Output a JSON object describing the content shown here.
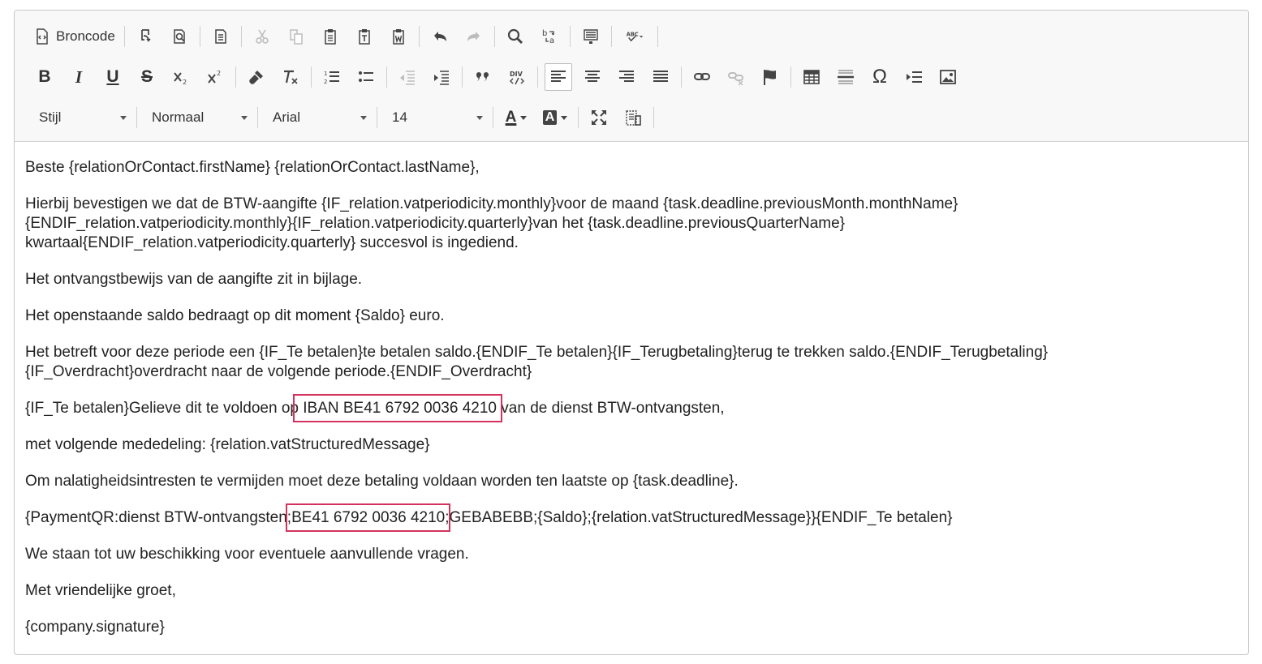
{
  "toolbar": {
    "source_label": "Broncode",
    "style_select": "Stijl",
    "format_select": "Normaal",
    "font_select": "Arial",
    "size_select": "14",
    "text_color_letter": "A",
    "bg_color_letter": "A",
    "bold_letter": "B",
    "italic_letter": "I",
    "underline_letter": "U",
    "strike_letter": "S",
    "omega_symbol": "Ω",
    "quote_symbol": "❞"
  },
  "content": {
    "greeting": "Beste {relationOrContact.firstName} {relationOrContact.lastName},",
    "p1_line1": "Hierbij bevestigen we dat de BTW-aangifte {IF_relation.vatperiodicity.monthly}voor de maand {task.deadline.previousMonth.monthName}",
    "p1_line2": "{ENDIF_relation.vatperiodicity.monthly}{IF_relation.vatperiodicity.quarterly}van het {task.deadline.previousQuarterName}",
    "p1_line3": "kwartaal{ENDIF_relation.vatperiodicity.quarterly} succesvol is ingediend.",
    "p2": "Het ontvangstbewijs van de aangifte zit in bijlage.",
    "p3": "Het openstaande saldo bedraagt op dit moment {Saldo} euro.",
    "p4_line1": "Het betreft voor deze periode een {IF_Te betalen}te betalen saldo.{ENDIF_Te betalen}{IF_Terugbetaling}terug te trekken saldo.{ENDIF_Terugbetaling}",
    "p4_line2": "{IF_Overdracht}overdracht naar de volgende periode.{ENDIF_Overdracht}",
    "p5_before": "{IF_Te betalen}Gelieve dit te voldoen op",
    "p5_highlight": " IBAN BE41 6792 0036 4210",
    "p5_after": " van de dienst BTW-ontvangsten,",
    "p6": "met volgende mededeling: {relation.vatStructuredMessage}",
    "p7": "Om nalatigheidsintresten te vermijden moet deze betaling voldaan worden ten laatste op {task.deadline}.",
    "p8_before": "{PaymentQR:dienst BTW-ontvangsten;",
    "p8_highlight": "BE41 6792 0036 4210",
    "p8_after": ";GEBABEBB;{Saldo};{relation.vatStructuredMessage}}{ENDIF_Te betalen}",
    "p9": "We staan tot uw beschikking voor eventuele aanvullende vragen.",
    "p10": "Met vriendelijke groet,",
    "p11": "{company.signature}"
  },
  "colors": {
    "highlight_border": "#d4325e",
    "toolbar_bg": "#f8f8f8"
  }
}
